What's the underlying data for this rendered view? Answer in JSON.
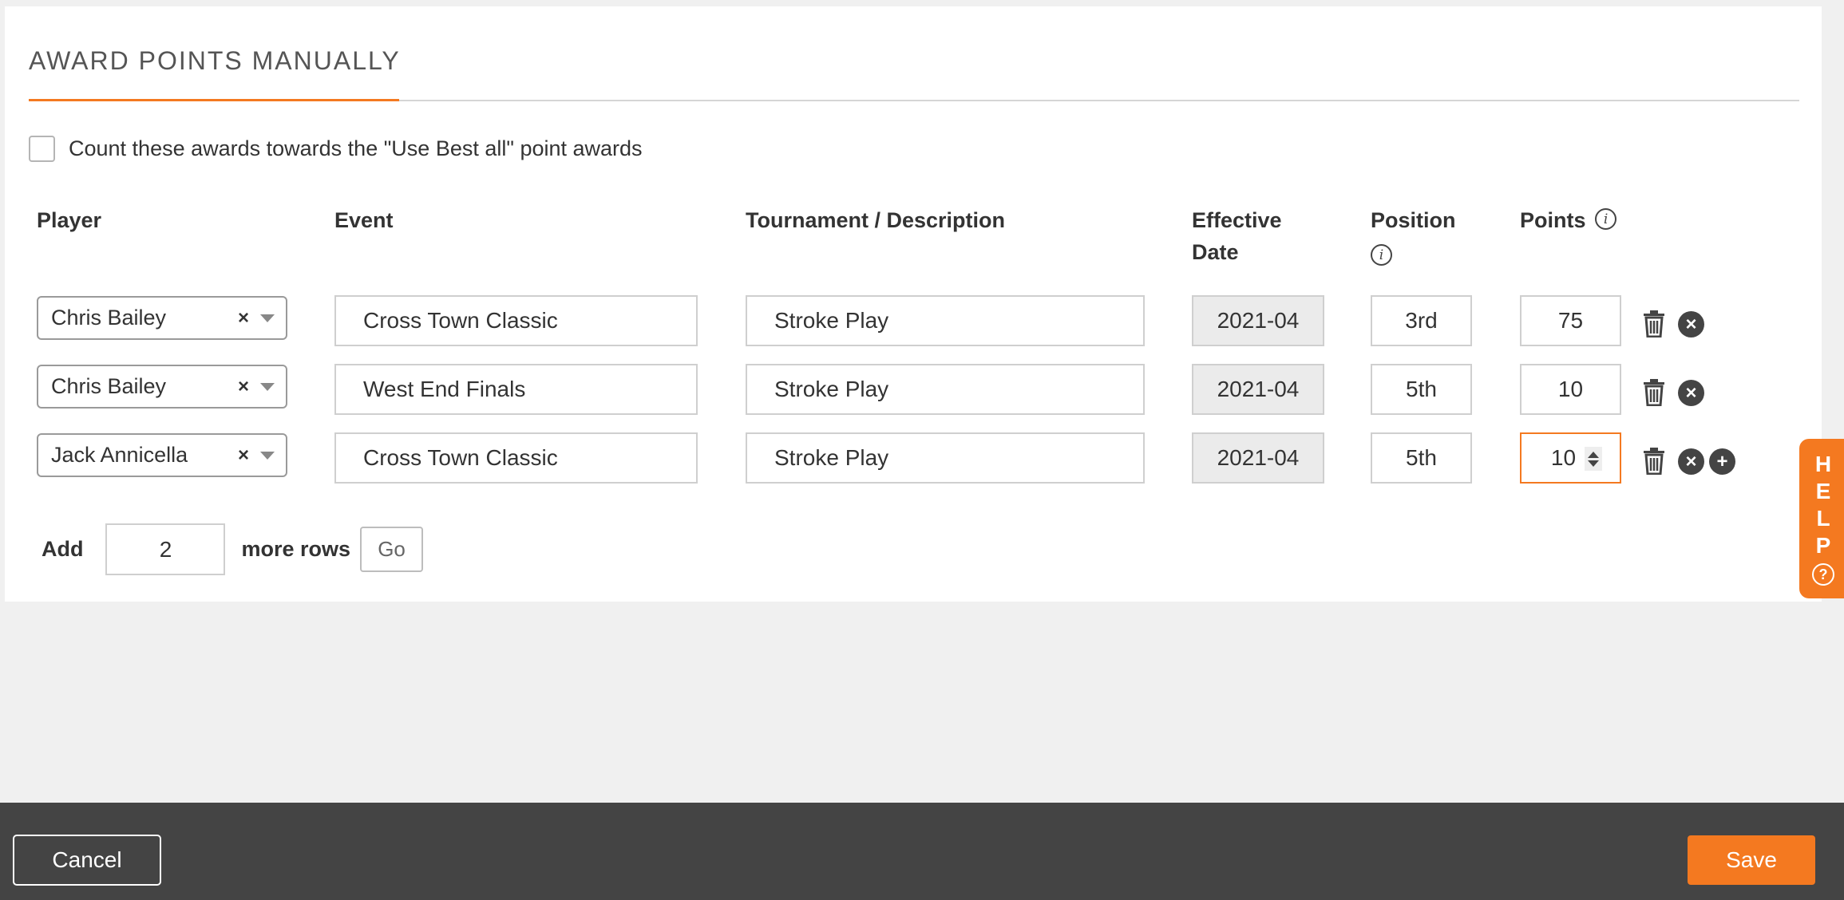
{
  "title": "AWARD POINTS MANUALLY",
  "count_awards_label": "Count these awards towards the \"Use Best all\" point awards",
  "columns": {
    "player": "Player",
    "event": "Event",
    "tournament": "Tournament / Description",
    "effective_date_line1": "Effective",
    "effective_date_line2": "Date",
    "position": "Position",
    "points": "Points"
  },
  "rows": [
    {
      "player": "Chris Bailey",
      "event": "Cross Town Classic",
      "tournament": "Stroke Play",
      "date": "2021-04",
      "position": "3rd",
      "points": "75"
    },
    {
      "player": "Chris Bailey",
      "event": "West End Finals",
      "tournament": "Stroke Play",
      "date": "2021-04",
      "position": "5th",
      "points": "10"
    },
    {
      "player": "Jack Annicella",
      "event": "Cross Town Classic",
      "tournament": "Stroke Play",
      "date": "2021-04",
      "position": "5th",
      "points": "10"
    }
  ],
  "add_rows": {
    "add_label": "Add",
    "count": "2",
    "more_label": "more rows",
    "go_label": "Go"
  },
  "help": {
    "letters": [
      "H",
      "E",
      "L",
      "P"
    ],
    "icon": "?"
  },
  "footer": {
    "cancel_label": "Cancel",
    "save_label": "Save"
  },
  "icons": {
    "info": "i",
    "clear": "×",
    "remove": "×",
    "add": "+"
  },
  "colors": {
    "accent": "#f47920",
    "footer_bg": "#444444",
    "page_bg": "#f0f0f0"
  }
}
